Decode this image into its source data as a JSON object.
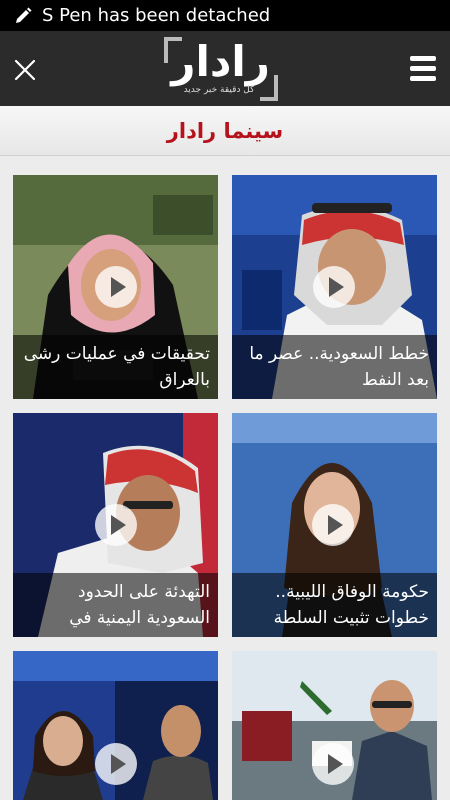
{
  "status_bar": {
    "text": "S Pen has been detached",
    "icon": "pen-icon"
  },
  "header": {
    "logo_text": "رادار",
    "logo_tagline": "كل دقيقة خبر جديد",
    "close_icon": "close-icon",
    "menu_icon": "hamburger-menu-icon"
  },
  "section": {
    "title": "سينما رادار"
  },
  "videos": [
    {
      "title": "خطط السعودية.. عصر ما بعد النفط"
    },
    {
      "title": "تحقيقات في عمليات رشى بالعراق"
    },
    {
      "title": "حكومة الوفاق الليبية.. خطوات تثبيت السلطة"
    },
    {
      "title": "التهدئة على الحدود السعودية اليمنية في"
    },
    {
      "title": ""
    },
    {
      "title": ""
    }
  ],
  "colors": {
    "accent": "#b5121b",
    "header_bg": "#2b2b2b",
    "status_bg": "#000000"
  }
}
